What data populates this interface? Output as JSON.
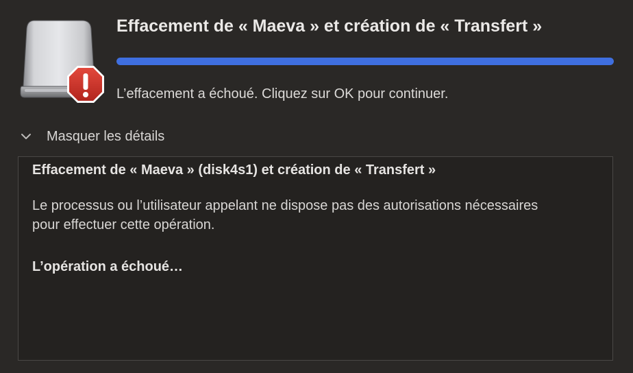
{
  "dialog": {
    "title": "Effacement de « Maeva » et création de « Transfert »",
    "status": "L’effacement a échoué. Cliquez sur OK pour continuer.",
    "progress": 1.0,
    "accent_color": "#3f6fe0",
    "icon": "external-disk-icon",
    "badge_icon": "error-badge-icon"
  },
  "details": {
    "toggle_label": "Masquer les détails",
    "toggle_icon": "chevron-down-icon",
    "heading": "Effacement de « Maeva » (disk4s1) et création de « Transfert »",
    "message": "Le processus ou l’utilisateur appelant ne dispose pas des autorisations nécessaires pour effectuer cette opération.",
    "result": "L’opération a échoué…"
  }
}
